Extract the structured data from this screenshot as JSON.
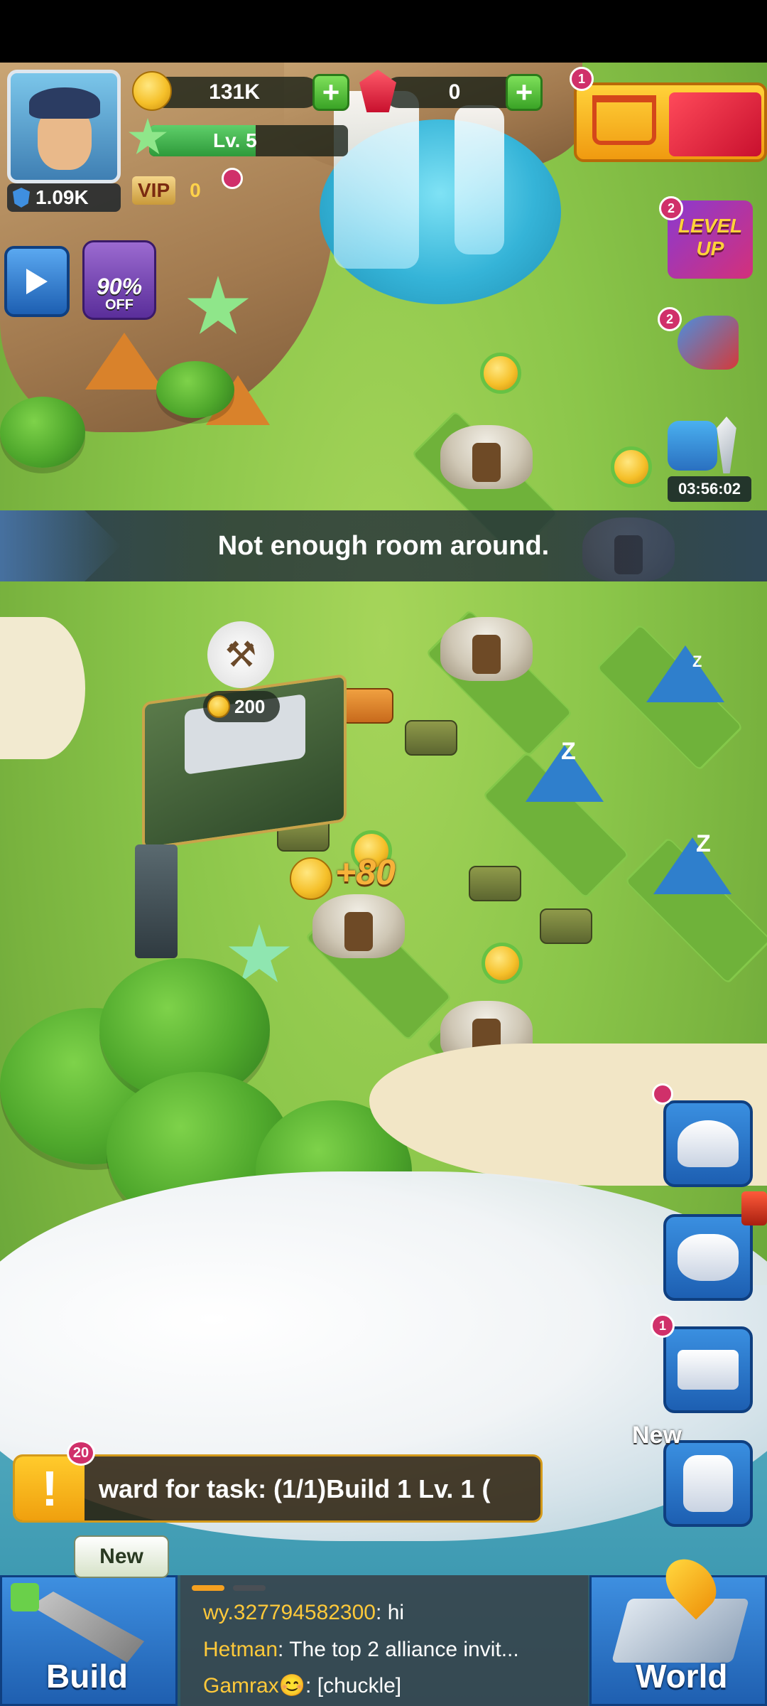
{
  "player": {
    "power": "1.09K",
    "level": "Lv. 5",
    "vip_label": "VIP",
    "vip_level": "0"
  },
  "resources": {
    "gold": "131K",
    "gems": "0"
  },
  "badges": {
    "shop": "1",
    "level_up": "2",
    "promo": "2",
    "mail": "1",
    "quest": "20"
  },
  "offers": {
    "discount": "90%",
    "discount_suffix": "OFF",
    "level_up_text": "LEVEL UP",
    "timer": "03:56:02"
  },
  "notice": {
    "message": "Not enough room around."
  },
  "map": {
    "build_cost": "200",
    "floating_gain": "+80"
  },
  "quest": {
    "text": "ward for task: (1/1)Build 1 Lv. 1 ("
  },
  "sidebar": {
    "new_tag": "New"
  },
  "build_button": {
    "label": "Build",
    "new_tag": "New"
  },
  "world_button": {
    "label": "World"
  },
  "chat": {
    "messages": [
      {
        "name": "wy.327794582300",
        "text": "hi"
      },
      {
        "name": "Hetman",
        "text": "The top 2 alliance invit..."
      },
      {
        "name": "Gamrax😊",
        "text": "[chuckle]"
      }
    ]
  },
  "colors": {
    "grass": "#8bc64a",
    "accent_gold": "#f5c02a",
    "button_blue": "#1f5fb0",
    "badge_pink": "#d0306a",
    "chat_name": "#ffc93a"
  }
}
